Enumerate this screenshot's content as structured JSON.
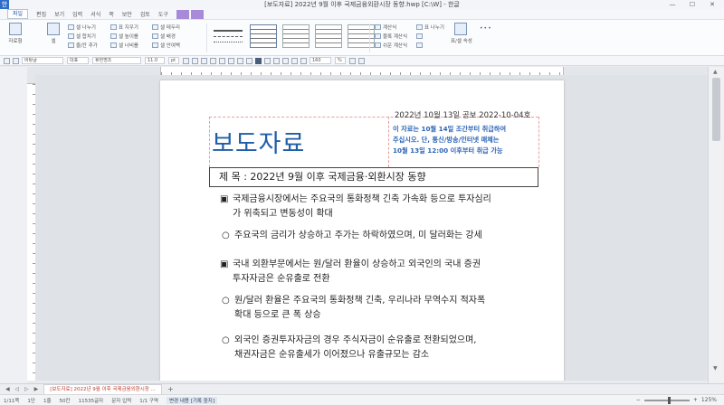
{
  "window": {
    "title": "[보도자료] 2022년 9월 이후 국제금융외환시장 동향.hwp [C:\\W] - 한글",
    "minimize": "—",
    "maximize": "☐",
    "close": "✕",
    "app_icon": "한"
  },
  "menu": {
    "items": [
      "파일",
      "편집",
      "보기",
      "입력",
      "서식",
      "쪽",
      "보안",
      "검토",
      "도구"
    ]
  },
  "ribbon": {
    "big_buttons": [
      "자료형",
      "셀",
      "표/셀 속성"
    ],
    "group1": [
      "셀 나누기",
      "셀 합치기",
      "줄/칸 추가"
    ],
    "group2": [
      "표 지우기",
      "셀 높이를",
      "셀 너비를",
      "표 나누기"
    ],
    "group3": [
      "셀 테두리",
      "셀 배경",
      "셀 안여백"
    ],
    "group4": [
      "계산식",
      "블록 계산식",
      "쉬운 계산식"
    ],
    "more": "•••"
  },
  "toolbar": {
    "style": "바탕글",
    "font_lang": "대표",
    "font": "휴먼명조",
    "size": "11.0",
    "unit": "pt",
    "line_spacing": "160",
    "spacing_unit": "%"
  },
  "document": {
    "pub_date": "2022년 10월 13일 공보  2022-10-04호",
    "heading": "보도자료",
    "embargo": [
      "이 자료는 10월 14일 조간부터 취급하여",
      "주십시오. 단, 통신/방송/인터넷 매체는",
      "10월 13일 12:00 이후부터 취급 가능"
    ],
    "subject": "제 목 : 2022년 9월 이후 국제금융·외환시장 동향",
    "bullets": [
      {
        "marker": "▣",
        "lines": [
          "국제금융시장에서는 주요국의 통화정책 긴축 가속화 등으로 투자심리",
          "가 위축되고 변동성이 확대"
        ]
      },
      {
        "marker": "○",
        "lines": [
          "주요국의 금리가 상승하고 주가는 하락하였으며, 미 달러화는 강세"
        ]
      },
      {
        "marker": "▣",
        "lines": [
          "국내 외환부문에서는 원/달러 환율이 상승하고 외국인의 국내 증권",
          "투자자금은 순유출로 전환"
        ]
      },
      {
        "marker": "○",
        "lines": [
          "원/달러 환율은 주요국의 통화정책 긴축, 우리나라 무역수지 적자폭",
          "확대 등으로 큰 폭 상승"
        ]
      },
      {
        "marker": "○",
        "lines": [
          "외국인 증권투자자금의 경우 주식자금이 순유출로 전환되었으며,",
          "채권자금은 순유출세가 이어졌으나 유출규모는 감소"
        ]
      }
    ]
  },
  "tabs": {
    "nav": "◀ ◁ ▷ ▶",
    "active": "[보도자료] 2022년 9월 이후 국제금융외환시장 ...",
    "add": "+"
  },
  "status": {
    "page": "1/11쪽",
    "section": "1단",
    "line": "1줄",
    "col": "50칸",
    "chars": "11535글자",
    "mode_hint": "문자 입력",
    "change": "변경 내용 [기록 중지]",
    "insert": "1/1 구역",
    "zoom": "125%",
    "zoom_level": 0.56
  }
}
